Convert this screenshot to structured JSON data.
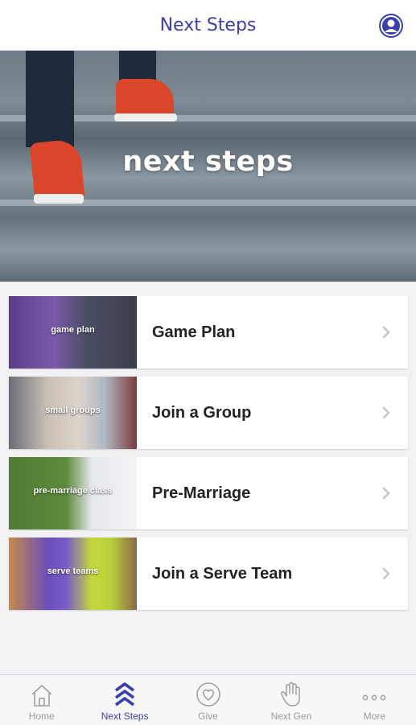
{
  "header": {
    "title": "Next Steps"
  },
  "hero": {
    "title": "next steps"
  },
  "cards": [
    {
      "thumb_label": "game plan",
      "title": "Game Plan"
    },
    {
      "thumb_label": "small groups",
      "title": "Join a Group"
    },
    {
      "thumb_label": "pre-marriage class",
      "title": "Pre-Marriage"
    },
    {
      "thumb_label": "serve teams",
      "title": "Join a Serve Team"
    }
  ],
  "tabs": [
    {
      "label": "Home",
      "icon": "home-icon"
    },
    {
      "label": "Next Steps",
      "icon": "stairs-chevrons-icon"
    },
    {
      "label": "Give",
      "icon": "heart-coin-icon"
    },
    {
      "label": "Next Gen",
      "icon": "hand-icon"
    },
    {
      "label": "More",
      "icon": "more-dots-icon"
    }
  ],
  "active_tab": "Next Steps",
  "colors": {
    "accent": "#3a3fae",
    "inactive": "#9a9aa0",
    "card_title": "#222222"
  }
}
